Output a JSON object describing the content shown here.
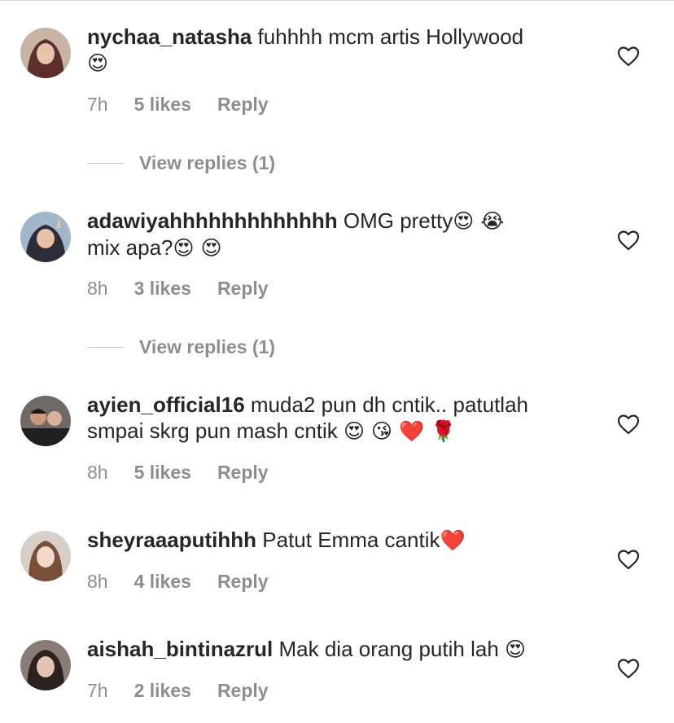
{
  "comments": [
    {
      "username": "nychaa_natasha",
      "text": " fuhhhh mcm artis Hollywood",
      "line2": "",
      "emoji_line": "😍",
      "time": "7h",
      "likes": "5 likes",
      "reply": "Reply",
      "view_replies": "View replies (1)",
      "avatar_colors": {
        "bg": "#c9b3a3",
        "hair": "#5b2f2a",
        "face": "#e8c4ad"
      }
    },
    {
      "username": "adawiyahhhhhhhhhhhhh",
      "text": " OMG pretty",
      "text_emoji": "😍 😭",
      "line2": "mix apa?",
      "line2_emoji": "😍 😍",
      "time": "8h",
      "likes": "3 likes",
      "reply": "Reply",
      "view_replies": "View replies (1)",
      "avatar_colors": {
        "bg": "#9fb7c9",
        "hair": "#2d2d3a",
        "face": "#e6c3a6"
      }
    },
    {
      "username": "ayien_official16",
      "text": " muda2 pun dh cntik.. patutlah",
      "line2": "smpai skrg pun mash cntik ",
      "line2_emoji": "😍 😘 ❤️ 🌹",
      "time": "8h",
      "likes": "5 likes",
      "reply": "Reply",
      "avatar_colors": {
        "bg": "#6f6a66",
        "hair": "#1b1b1b",
        "face": "#c99b7c"
      }
    },
    {
      "username": "sheyraaaputihhh",
      "text": " Patut Emma cantik",
      "text_emoji": "❤️",
      "time": "8h",
      "likes": "4 likes",
      "reply": "Reply",
      "avatar_colors": {
        "bg": "#d8cfc9",
        "hair": "#7a4f3a",
        "face": "#f1d9cc"
      }
    },
    {
      "username": "aishah_bintinazrul",
      "text": " Mak dia orang putih lah ",
      "text_emoji": "😍",
      "time": "7h",
      "likes": "2 likes",
      "reply": "Reply",
      "avatar_colors": {
        "bg": "#8a7d78",
        "hair": "#2b211d",
        "face": "#e3c2b1"
      }
    }
  ],
  "icons": {
    "like": "heart-outline-icon"
  },
  "colors": {
    "text": "#262626",
    "meta": "#8e8e8e",
    "divider": "#dbdbdb"
  }
}
